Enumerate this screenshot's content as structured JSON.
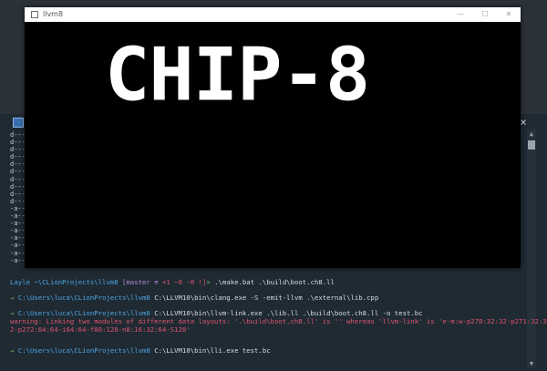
{
  "terminal": {
    "icon": "powershell-icon",
    "close_icon": "×",
    "scroll_up": "▲",
    "scroll_down": "▼",
    "listing": [
      "d---",
      "d---",
      "d---",
      "d---",
      "d---",
      "d---",
      "d---",
      "d---",
      "d---",
      "d---",
      "-a--",
      "-a--",
      "-a--",
      "-a--",
      "-a--",
      "-a--",
      "-a--",
      "-a--"
    ],
    "line1": {
      "user": "Layle",
      "path": "~\\CLionProjects\\llvm8",
      "branch": "[master ≡",
      "status": "+1 ~0 -0 !]",
      "arrow": ">",
      "command": ".\\make.bat .\\build\\boot.ch8.ll"
    },
    "line2": {
      "arrow": "→",
      "path": "C:\\Users\\luca\\CLionProjects\\llvm8",
      "command": "C:\\LLVM10\\bin\\clang.exe -S -emit-llvm .\\external\\lib.cpp"
    },
    "line3": {
      "arrow": "→",
      "path": "C:\\Users\\luca\\CLionProjects\\llvm8",
      "command": "C:\\LLVM10\\bin\\llvm-link.exe .\\lib.ll .\\build\\boot.ch8.ll -o test.bc"
    },
    "warning_line1": "warning: Linking two modules of different data layouts: '.\\build\\boot.ch8.ll' is '' whereas 'llvm-link' is 'e-m:w-p270:32:32-p271:32:3",
    "warning_line2": "2-p272:64:64-i64:64-f80:128-n8:16:32:64-S128'",
    "line4": {
      "arrow": "→",
      "path": "C:\\Users\\luca\\CLionProjects\\llvm8",
      "command": "C:\\LLVM10\\bin\\lli.exe test.bc"
    }
  },
  "window": {
    "title": "llvm8",
    "minimize": "—",
    "maximize": "☐",
    "close": "✕",
    "display_text": "CHIP-8"
  }
}
